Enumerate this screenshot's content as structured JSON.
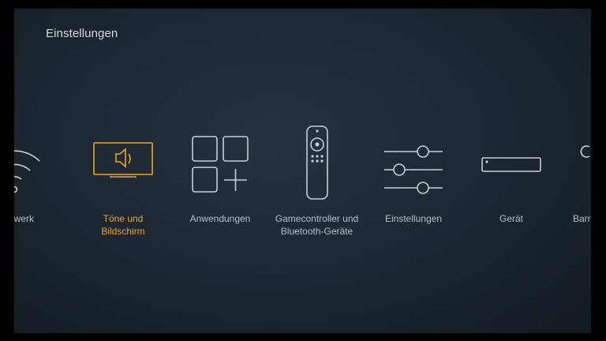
{
  "header": {
    "title": "Einstellungen"
  },
  "accent_color": "#f0a51b",
  "tiles": [
    {
      "icon": "wifi-icon",
      "line1": "Netzwerk",
      "line2": ""
    },
    {
      "icon": "sound-screen-icon",
      "line1": "Töne und",
      "line2": "Bildschirm",
      "selected": true
    },
    {
      "icon": "apps-grid-icon",
      "line1": "Anwendungen",
      "line2": ""
    },
    {
      "icon": "remote-icon",
      "line1": "Gamecontroller und",
      "line2": "Bluetooth-Geräte"
    },
    {
      "icon": "sliders-icon",
      "line1": "Einstellungen",
      "line2": ""
    },
    {
      "icon": "device-icon",
      "line1": "Gerät",
      "line2": ""
    },
    {
      "icon": "accessibility-icon",
      "line1": "Barrierefreiheit",
      "line2": ""
    }
  ]
}
